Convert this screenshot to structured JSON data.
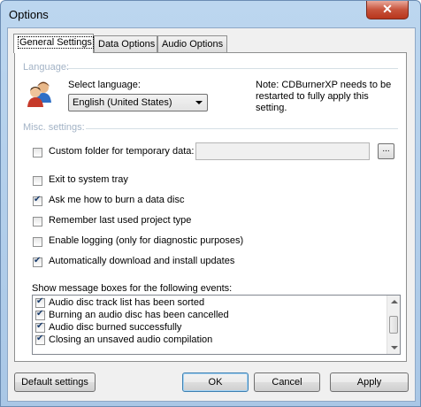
{
  "window": {
    "title": "Options",
    "close_glyph": "✕"
  },
  "tabs": [
    {
      "label": "General Settings"
    },
    {
      "label": "Data Options"
    },
    {
      "label": "Audio Options"
    }
  ],
  "language": {
    "group_label": "Language:",
    "select_label": "Select language:",
    "selected": "English (United States)",
    "note": [
      "Note: CDBurnerXP needs to be",
      "restarted to fully apply this",
      "setting."
    ]
  },
  "misc": {
    "group_label": "Misc. settings:",
    "custom_folder": {
      "label": "Custom folder for temporary data:",
      "checked": false,
      "value": "",
      "browse_label": "..."
    },
    "options": [
      {
        "label": "Exit to system tray",
        "checked": false
      },
      {
        "label": "Ask me how to burn a data disc",
        "checked": true
      },
      {
        "label": "Remember last used project type",
        "checked": false
      },
      {
        "label": "Enable logging (only for diagnostic purposes)",
        "checked": false
      },
      {
        "label": "Automatically download and install updates",
        "checked": true
      }
    ]
  },
  "messages": {
    "label": "Show message boxes for the following events:",
    "items": [
      {
        "label": "Audio disc track list has been sorted",
        "checked": true
      },
      {
        "label": "Burning an audio disc has been cancelled",
        "checked": true
      },
      {
        "label": "Audio disc burned successfully",
        "checked": true
      },
      {
        "label": "Closing an unsaved audio compilation",
        "checked": true
      }
    ]
  },
  "buttons": {
    "default_settings": "Default settings",
    "ok": "OK",
    "cancel": "Cancel",
    "apply": "Apply"
  }
}
